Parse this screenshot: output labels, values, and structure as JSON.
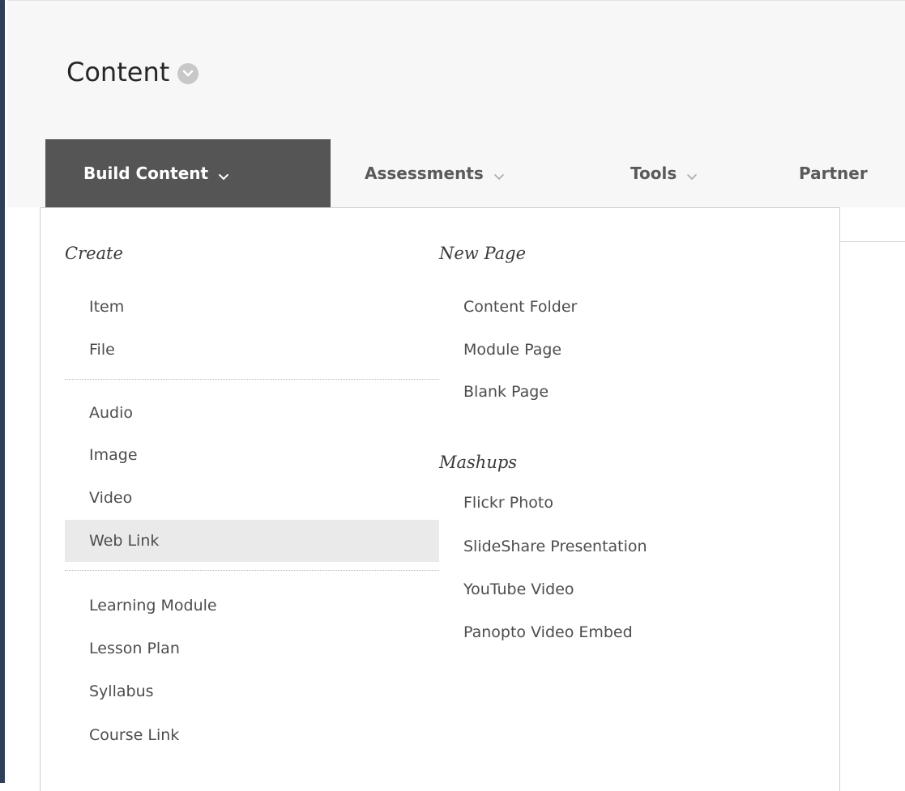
{
  "header": {
    "title": "Content"
  },
  "tabs": [
    {
      "label": "Build Content",
      "active": true
    },
    {
      "label": "Assessments",
      "active": false
    },
    {
      "label": "Tools",
      "active": false
    },
    {
      "label": "Partner",
      "active": false
    }
  ],
  "dropdown": {
    "create": {
      "heading": "Create",
      "items": [
        "Item",
        "File",
        "Audio",
        "Image",
        "Video",
        "Web Link",
        "Learning Module",
        "Lesson Plan",
        "Syllabus",
        "Course Link"
      ],
      "highlighted": "Web Link"
    },
    "new_page": {
      "heading": "New Page",
      "items": [
        "Content Folder",
        "Module Page",
        "Blank Page"
      ]
    },
    "mashups": {
      "heading": "Mashups",
      "items": [
        "Flickr Photo",
        "SlideShare Presentation",
        "YouTube Video",
        "Panopto Video Embed"
      ]
    }
  },
  "colors": {
    "active_tab_bg": "#555555",
    "header_bg": "#f7f7f7",
    "highlight_bg": "#eaeaea",
    "left_border": "#2f3f56"
  },
  "icons": {
    "title_options": "chevron-circle-icon",
    "tab_dropdown": "chevron-down-icon"
  }
}
